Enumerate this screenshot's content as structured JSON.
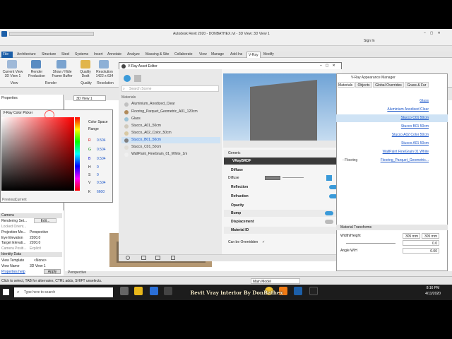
{
  "window": {
    "title": "Autodesk Revit 2020 - DONBATHEX.rvt - 3D View: 3D View 1",
    "sign_in": "Sign In"
  },
  "ribbon_tabs": [
    "File",
    "Architecture",
    "Structure",
    "Steel",
    "Systems",
    "Insert",
    "Annotate",
    "Analyze",
    "Massing & Site",
    "Collaborate",
    "View",
    "Manage",
    "Add-Ins",
    "V-Ray",
    "Modify"
  ],
  "ribbon": {
    "current_view": "Current View\n3D View 1",
    "render": "Render\nProduction",
    "frame_buffer": "Show / Hide\nFrame Buffer",
    "quality": "Quality\nDraft",
    "resolution": "Resolution\n1422 x 634",
    "groups": [
      "View",
      "Render",
      "Quality",
      "Resolution"
    ]
  },
  "properties": {
    "title": "Properties",
    "section_camera": "Camera",
    "rows": [
      {
        "label": "Rendering Set...",
        "value": "Edit..."
      },
      {
        "label": "Locked Orient...",
        "value": ""
      },
      {
        "label": "Projection Mo...",
        "value": "Perspective"
      },
      {
        "label": "Eye Elevation",
        "value": "2200.0"
      },
      {
        "label": "Target Elevati...",
        "value": "2200.0"
      },
      {
        "label": "Camera Positi...",
        "value": "Explicit"
      }
    ],
    "section_identity": "Identity Data",
    "rows2": [
      {
        "label": "View Template",
        "value": "<None>"
      },
      {
        "label": "View Name",
        "value": "3D View 1"
      }
    ],
    "help": "Properties help",
    "apply": "Apply"
  },
  "view_tab": "3D View 1",
  "color_picker": {
    "title": "V-Ray Color Picker",
    "color_space_label": "Color Space",
    "range_label": "Range",
    "r": "0.504",
    "g": "0.504",
    "b": "0.504",
    "h": "0",
    "s": "0",
    "v": "0.504",
    "k": "6600",
    "previous": "Previous",
    "current": "Current"
  },
  "asset_editor": {
    "title": "V-Ray Asset Editor",
    "search_placeholder": "Search Scene",
    "materials_header": "Materials",
    "materials": [
      "Aluminium_Anodized_Clear",
      "Flooring_Parquet_Geometric_A01_120cm",
      "Glass",
      "Stucco_A01_50cm",
      "Stucco_A02_Color_50cm",
      "Stucco_B01_50cm",
      "Stucco_C01_50cm",
      "WallPaint_FineGrain_01_White_1m"
    ],
    "selected_index": 5,
    "generic": "Generic",
    "brdf": "VRayBRDF",
    "sections": [
      "Diffuse",
      "Reflection",
      "Refraction",
      "Opacity",
      "Bump",
      "Displacement",
      "Material ID"
    ],
    "diffuse_label": "Diffuse",
    "can_be_overridden": "Can be Overridden"
  },
  "appearance_manager": {
    "title": "V-Ray Appearance Manager",
    "tabs": [
      "Materials",
      "Objects",
      "Global Overrides",
      "Grass & Fur"
    ],
    "rows": [
      {
        "left": "",
        "value": "Glass"
      },
      {
        "left": "",
        "value": "Aluminium Anodized Clear"
      },
      {
        "left": "",
        "value": "Stucco C01 50cm"
      },
      {
        "left": "",
        "value": "Stucco B01 50cm"
      },
      {
        "left": "",
        "value": "Stucco A02 Color 50cm"
      },
      {
        "left": "",
        "value": "Stucco A01 50cm"
      },
      {
        "left": "",
        "value": "WallPaint FineGrain 01 White"
      },
      {
        "left": "- Flooring",
        "value": "Flooring_Parquet_Geometric..."
      }
    ],
    "transforms": "Material Transforms",
    "width_height": "Width/Height",
    "width_value": "305 mm",
    "height_value": "305 mm",
    "offset_value": "0.0",
    "rotation_value": "0.00",
    "rotation_label": "Angle W/H"
  },
  "status": {
    "hint": "Click to select, TAB for alternates, CTRL adds, SHIFT unselects.",
    "model": "Main Model",
    "perspective": "Perspective"
  },
  "taskbar": {
    "search_placeholder": "Type here to search",
    "time": "8:16 PM",
    "date": "4/11/2020"
  },
  "watermark": "Revit Vray interior By DonBathex"
}
